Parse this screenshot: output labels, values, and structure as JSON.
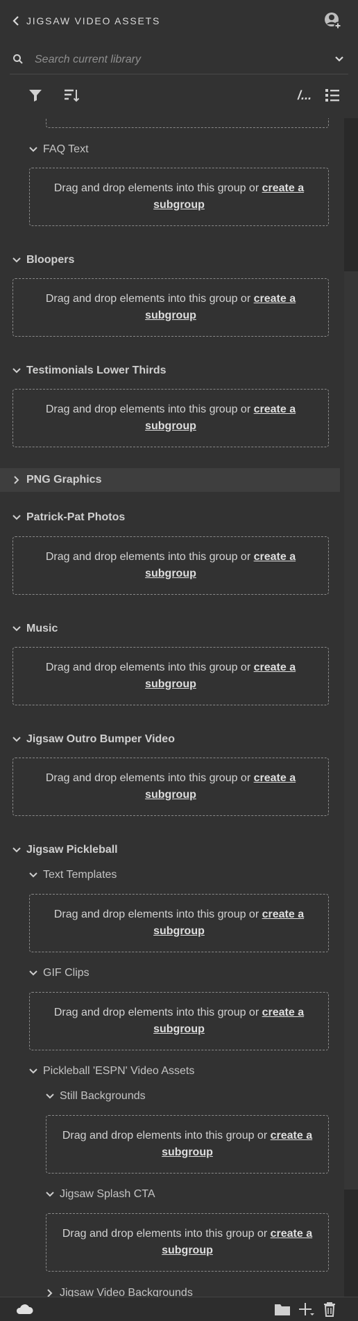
{
  "header": {
    "back_icon": "chevron-left-icon",
    "title": "JIGSAW VIDEO ASSETS",
    "account_icon": "account-plus-icon"
  },
  "search": {
    "placeholder": "Search current library",
    "value": ""
  },
  "toolbar": {
    "path_label": "/...",
    "icons": [
      "filter-icon",
      "sort-icon",
      "path-icon",
      "list-view-icon"
    ]
  },
  "dropzone": {
    "text": "Drag and drop elements into this group or ",
    "link": "create a subgroup"
  },
  "groups": {
    "faq_text": "FAQ Text",
    "bloopers": "Bloopers",
    "testimonials": "Testimonials Lower Thirds",
    "png_graphics": "PNG Graphics",
    "patrick_pat": "Patrick-Pat Photos",
    "music": "Music",
    "outro_bumper": "Jigsaw Outro Bumper Video",
    "pickleball": "Jigsaw Pickleball",
    "text_templates": "Text Templates",
    "gif_clips": "GIF Clips",
    "espn_assets": "Pickleball 'ESPN' Video Assets",
    "still_backgrounds": "Still Backgrounds",
    "splash_cta": "Jigsaw Splash CTA",
    "video_backgrounds": "Jigsaw Video Backgrounds"
  },
  "footer": {
    "icons": [
      "cloud-icon",
      "new-folder-icon",
      "add-icon",
      "trash-icon"
    ]
  },
  "colors": {
    "background": "#323232",
    "text": "#d4d4d4",
    "dashed_border": "#8a8a8a",
    "highlight": "#3e3e3e"
  }
}
